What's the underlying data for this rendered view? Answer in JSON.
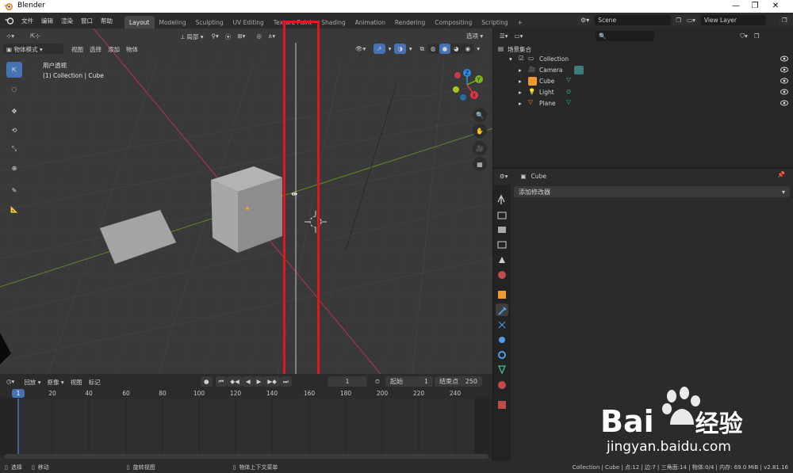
{
  "window": {
    "title": "Blender"
  },
  "menu": [
    "文件",
    "编辑",
    "渲染",
    "窗口",
    "帮助"
  ],
  "workspaces": [
    "Layout",
    "Modeling",
    "Sculpting",
    "UV Editing",
    "Texture Paint",
    "Shading",
    "Animation",
    "Rendering",
    "Compositing",
    "Scripting"
  ],
  "scene": {
    "name": "Scene",
    "view_layer": "View Layer"
  },
  "viewport": {
    "mode": "物体模式",
    "menus": [
      "视图",
      "选择",
      "添加",
      "物体"
    ],
    "transform_orientation": "局部",
    "options_label": "选项",
    "overlay_title": "用户透视",
    "overlay_collection": "(1) Collection | Cube",
    "axis_labels": {
      "x": "X",
      "y": "Y",
      "z": "Z"
    }
  },
  "timeline": {
    "menus": [
      "回放",
      "抠像",
      "视图",
      "标记"
    ],
    "current_frame": "1",
    "start_label": "起始",
    "start_value": "1",
    "end_label": "结束点",
    "end_value": "250",
    "ruler": [
      "1",
      "20",
      "40",
      "60",
      "80",
      "100",
      "120",
      "140",
      "160",
      "180",
      "200",
      "220",
      "240"
    ]
  },
  "outliner": {
    "root": "场景集合",
    "collection": "Collection",
    "items": [
      "Camera",
      "Cube",
      "Light",
      "Plane"
    ]
  },
  "properties": {
    "object_name": "Cube",
    "add_modifier": "添加修改器"
  },
  "status": {
    "select": "选择",
    "move": "移动",
    "rotate_view": "旋转视图",
    "context_menu": "物体上下文菜单",
    "stats": "Collection | Cube | 点:12 | 边:7 | 三角面:14 | 物体:0/4 | 内存: 69.0 MiB | v2.81.16"
  },
  "watermark": {
    "brand": "Bai",
    "brand2": "经验",
    "url": "jingyan.baidu.com"
  },
  "colors": {
    "accent": "#4772b3",
    "highlight_box": "#e0171f",
    "x_axis": "#e2364a",
    "y_axis": "#7ab51c",
    "z_axis": "#2d8ce6"
  }
}
